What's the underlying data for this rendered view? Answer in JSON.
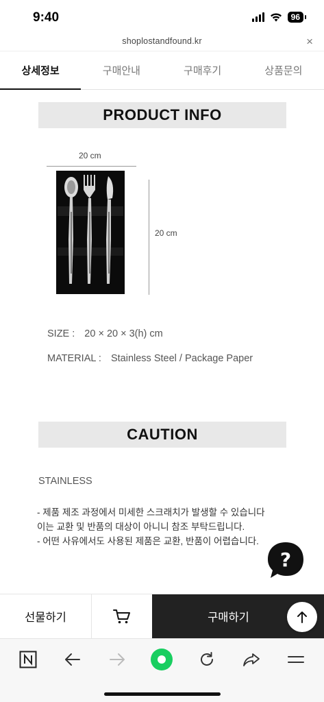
{
  "status_bar": {
    "time": "9:40",
    "battery": "96"
  },
  "url_bar": {
    "url": "shoplostandfound.kr",
    "close": "×"
  },
  "tabs": [
    {
      "label": "상세정보",
      "active": true
    },
    {
      "label": "구매안내",
      "active": false
    },
    {
      "label": "구매후기",
      "active": false
    },
    {
      "label": "상품문의",
      "active": false
    }
  ],
  "product_info": {
    "heading": "PRODUCT INFO",
    "width_label": "20 cm",
    "height_label": "20 cm",
    "size_label": "SIZE :",
    "size_value": "20 × 20 × 3(h) cm",
    "material_label": "MATERIAL :",
    "material_value": "Stainless Steel / Package Paper"
  },
  "caution": {
    "heading": "CAUTION",
    "subheading": "STAINLESS",
    "lines": [
      "- 제품 제조 과정에서 미세한 스크래치가 발생할 수 있습니다",
      "이는 교환 및 반품의 대상이 아니니 참조 부탁드립니다.",
      "- 어떤 사유에서도 사용된 제품은 교환, 반품이 어렵습니다."
    ]
  },
  "purchase_bar": {
    "gift_label": "선물하기",
    "buy_label": "구매하기"
  },
  "icons": {
    "help": "question-bubble-icon",
    "cart": "cart-icon",
    "top": "arrow-up-icon",
    "naver": "naver-n-icon",
    "back": "arrow-left-icon",
    "forward": "arrow-right-icon",
    "green_dot": "green-dot-icon",
    "reload": "reload-icon",
    "share": "share-icon",
    "menu": "menu-icon"
  },
  "colors": {
    "accent_green": "#19ce60",
    "buy_button": "#222222",
    "banner_bg": "#e8e8e8"
  }
}
